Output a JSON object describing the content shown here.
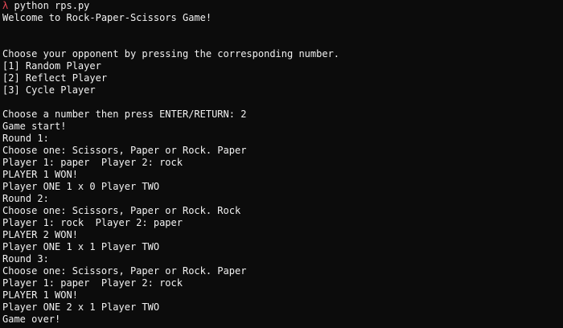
{
  "prompt": {
    "symbol": "λ",
    "command": "python rps.py"
  },
  "output": {
    "welcome": "Welcome to Rock-Paper-Scissors Game!",
    "choose_opponent": "Choose your opponent by pressing the corresponding number.",
    "options": [
      "[1] Random Player",
      "[2] Reflect Player",
      "[3] Cycle Player"
    ],
    "choose_number": "Choose a number then press ENTER/RETURN: 2",
    "game_start": "Game start!",
    "rounds": [
      {
        "title": "Round 1:",
        "choose": "Choose one: Scissors, Paper or Rock. Paper",
        "moves": "Player 1: paper  Player 2: rock",
        "result": "PLAYER 1 WON!",
        "score": "Player ONE 1 x 0 Player TWO"
      },
      {
        "title": "Round 2:",
        "choose": "Choose one: Scissors, Paper or Rock. Rock",
        "moves": "Player 1: rock  Player 2: paper",
        "result": "PLAYER 2 WON!",
        "score": "Player ONE 1 x 1 Player TWO"
      },
      {
        "title": "Round 3:",
        "choose": "Choose one: Scissors, Paper or Rock. Paper",
        "moves": "Player 1: paper  Player 2: rock",
        "result": "PLAYER 1 WON!",
        "score": "Player ONE 2 x 1 Player TWO"
      }
    ],
    "game_over": "Game over!"
  },
  "colors": {
    "background": "#0c0c0c",
    "text": "#f2f2f2",
    "prompt_symbol": "#e74856"
  }
}
